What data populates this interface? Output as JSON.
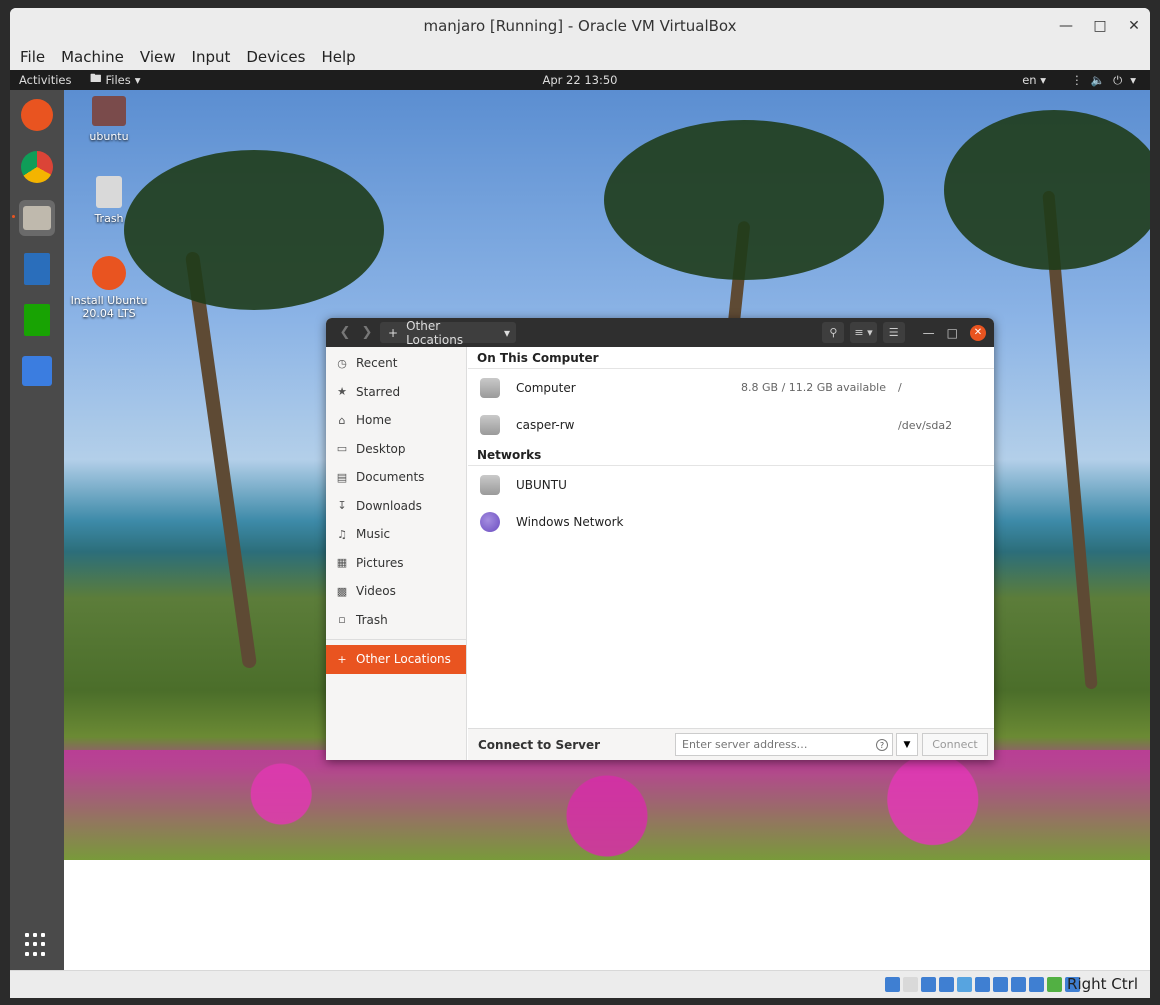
{
  "window": {
    "title": "manjaro [Running] - Oracle VM VirtualBox"
  },
  "vb_menu": [
    "File",
    "Machine",
    "View",
    "Input",
    "Devices",
    "Help"
  ],
  "topbar": {
    "activities": "Activities",
    "app_menu": "Files",
    "clock": "Apr 22  13:50",
    "language": "en"
  },
  "desktop_icons": [
    {
      "label": "ubuntu",
      "icon": "home-folder-icon"
    },
    {
      "label": "Trash",
      "icon": "trash-icon"
    },
    {
      "label": "Install Ubuntu 20.04 LTS",
      "icon": "ubuntu-installer-icon"
    }
  ],
  "dock_apps": [
    {
      "name": "ubuntu-logo",
      "color": "#e95420"
    },
    {
      "name": "chrome",
      "color": "#4285f4"
    },
    {
      "name": "files",
      "color": "#bfb9ad"
    },
    {
      "name": "writer",
      "color": "#2a6ebb"
    },
    {
      "name": "calc",
      "color": "#18a303"
    },
    {
      "name": "screenshot",
      "color": "#3b7de0"
    }
  ],
  "files": {
    "path": "Other Locations",
    "sidebar": [
      {
        "label": "Recent",
        "icon": "clock-icon"
      },
      {
        "label": "Starred",
        "icon": "star-icon"
      },
      {
        "label": "Home",
        "icon": "home-icon"
      },
      {
        "label": "Desktop",
        "icon": "desktop-icon"
      },
      {
        "label": "Documents",
        "icon": "document-icon"
      },
      {
        "label": "Downloads",
        "icon": "download-icon"
      },
      {
        "label": "Music",
        "icon": "music-icon"
      },
      {
        "label": "Pictures",
        "icon": "picture-icon"
      },
      {
        "label": "Videos",
        "icon": "video-icon"
      },
      {
        "label": "Trash",
        "icon": "trash-icon"
      },
      {
        "label": "Other Locations",
        "icon": "plus-icon"
      }
    ],
    "sections": {
      "on_this_computer": "On This Computer",
      "networks": "Networks"
    },
    "computer_rows": [
      {
        "name": "Computer",
        "info": "8.8 GB / 11.2 GB available",
        "mount": "/"
      },
      {
        "name": "casper-rw",
        "info": "",
        "mount": "/dev/sda2"
      }
    ],
    "network_rows": [
      {
        "name": "UBUNTU"
      },
      {
        "name": "Windows Network"
      }
    ],
    "footer": {
      "label": "Connect to Server",
      "placeholder": "Enter server address…",
      "connect": "Connect"
    }
  },
  "statusbar": {
    "host_key": "Right Ctrl"
  },
  "colors": {
    "accent": "#e95420",
    "panel": "#1d1d1d"
  }
}
